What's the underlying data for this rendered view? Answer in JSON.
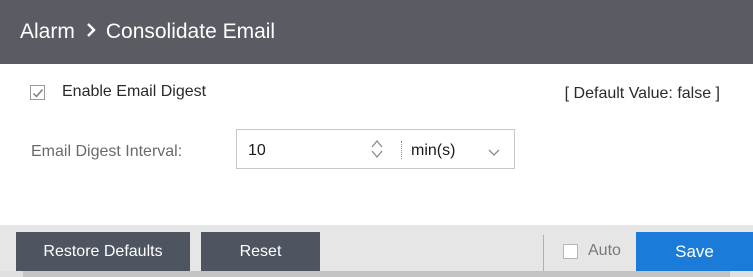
{
  "header": {
    "breadcrumb_parent": "Alarm",
    "breadcrumb_current": "Consolidate Email"
  },
  "settings": {
    "enable_digest_label": "Enable Email Digest",
    "enable_digest_checked": true,
    "default_value_note": "[ Default Value: false ]",
    "interval_label": "Email Digest Interval:",
    "interval_value": "10",
    "interval_unit": "min(s)"
  },
  "footer": {
    "restore_defaults_label": "Restore Defaults",
    "reset_label": "Reset",
    "auto_label": "Auto",
    "auto_checked": false,
    "save_label": "Save"
  },
  "colors": {
    "header_bg": "#5b5b63",
    "dark_button": "#4e5560",
    "save_button": "#1a7bd8"
  },
  "icons": {
    "breadcrumb_separator": "chevron-right-icon",
    "stepper": "stepper-up-down-icon",
    "dropdown": "chevron-down-icon"
  }
}
